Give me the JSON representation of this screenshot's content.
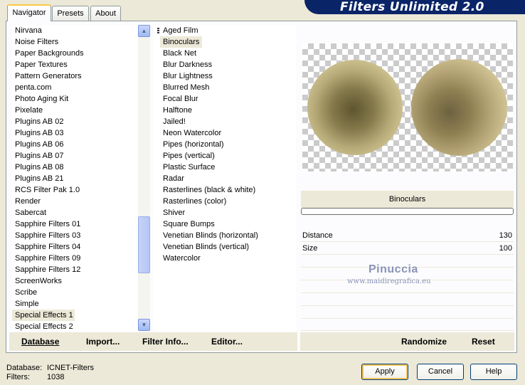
{
  "tabs": [
    {
      "label": "Navigator"
    },
    {
      "label": "Presets"
    },
    {
      "label": "About"
    }
  ],
  "banner": {
    "title": "Filters Unlimited 2.0"
  },
  "categories": [
    "Nirvana",
    "Noise Filters",
    "Paper Backgrounds",
    "Paper Textures",
    "Pattern Generators",
    "penta.com",
    "Photo Aging Kit",
    "Pixelate",
    "Plugins AB 02",
    "Plugins AB 03",
    "Plugins AB 06",
    "Plugins AB 07",
    "Plugins AB 08",
    "Plugins AB 21",
    "RCS Filter Pak 1.0",
    "Render",
    "Sabercat",
    "Sapphire Filters 01",
    "Sapphire Filters 03",
    "Sapphire Filters 04",
    "Sapphire Filters 09",
    "Sapphire Filters 12",
    "ScreenWorks",
    "Scribe",
    "Simple",
    "Special Effects 1",
    "Special Effects 2"
  ],
  "selected_category": "Special Effects 1",
  "filters": [
    "Aged Film",
    "Binoculars",
    "Black Net",
    "Blur Darkness",
    "Blur Lightness",
    "Blurred Mesh",
    "Focal Blur",
    "Halftone",
    "Jailed!",
    "Neon Watercolor",
    "Pipes (horizontal)",
    "Pipes (vertical)",
    "Plastic Surface",
    "Radar",
    "Rasterlines (black & white)",
    "Rasterlines (color)",
    "Shiver",
    "Square Bumps",
    "Venetian Blinds (horizontal)",
    "Venetian Blinds (vertical)",
    "Watercolor"
  ],
  "selected_filter": "Binoculars",
  "filter_name": "Binoculars",
  "params": [
    {
      "label": "Distance",
      "value": "130"
    },
    {
      "label": "Size",
      "value": "100"
    }
  ],
  "watermark": {
    "name": "Pinuccia",
    "url": "www.maidiregrafica.eu"
  },
  "bottom_links": {
    "database": "Database",
    "import": "Import...",
    "filter_info": "Filter Info...",
    "editor": "Editor...",
    "randomize": "Randomize",
    "reset": "Reset"
  },
  "status": {
    "database_label": "Database:",
    "database_value": "ICNET-Filters",
    "filters_label": "Filters:",
    "filters_value": "1038"
  },
  "buttons": {
    "apply": "Apply",
    "cancel": "Cancel",
    "help": "Help"
  }
}
